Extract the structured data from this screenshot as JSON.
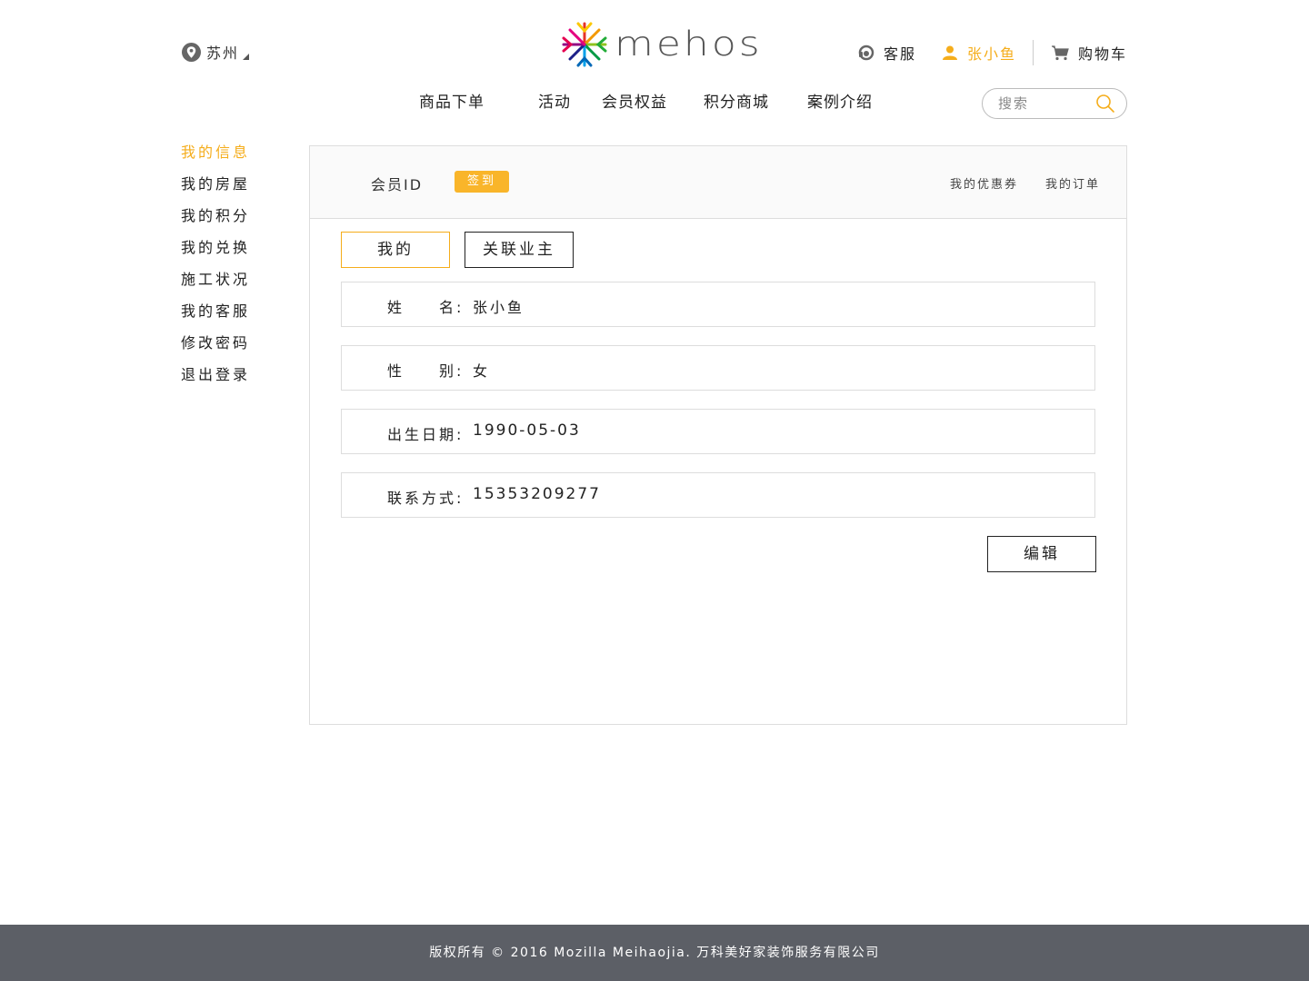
{
  "header": {
    "city": "苏州",
    "logo_text": "mehos",
    "service_label": "客服",
    "user_name": "张小鱼",
    "cart_label": "购物车",
    "search_placeholder": "搜索",
    "accent_color": "#f5ad1b"
  },
  "nav": {
    "items": [
      "商品下单",
      "活动",
      "会员权益",
      "积分商城",
      "案例介绍"
    ]
  },
  "sidebar": {
    "items": [
      {
        "label": "我的信息",
        "active": true
      },
      {
        "label": "我的房屋",
        "active": false
      },
      {
        "label": "我的积分",
        "active": false
      },
      {
        "label": "我的兑换",
        "active": false
      },
      {
        "label": "施工状况",
        "active": false
      },
      {
        "label": "我的客服",
        "active": false
      },
      {
        "label": "修改密码",
        "active": false
      },
      {
        "label": "退出登录",
        "active": false
      }
    ]
  },
  "profile": {
    "member_id_label": "会员ID",
    "checkin_label": "签到",
    "coupons_label": "我的优惠券",
    "orders_label": "我的订单",
    "tabs": [
      {
        "label": "我的",
        "active": true
      },
      {
        "label": "关联业主",
        "active": false
      }
    ],
    "fields": [
      {
        "label": "姓　　名:",
        "value": "张小鱼"
      },
      {
        "label": "性　　别:",
        "value": "女"
      },
      {
        "label": "出生日期:",
        "value": "1990-05-03"
      },
      {
        "label": "联系方式:",
        "value": "15353209277"
      }
    ],
    "edit_label": "编辑"
  },
  "footer": {
    "copyright": "版权所有 © 2016 Mozilla Meihaojia. 万科美好家装饰服务有限公司"
  }
}
